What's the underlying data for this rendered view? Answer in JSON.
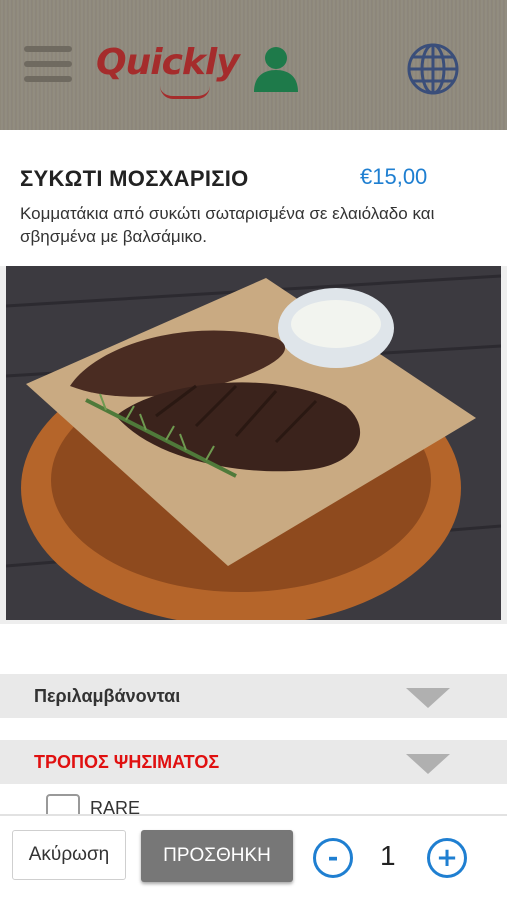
{
  "app": {
    "logo_text": "Quickly"
  },
  "product": {
    "name": "ΣΥΚΩΤΙ ΜΟΣΧΑΡΙΣΙΟ",
    "price": "€15,00",
    "description": "Κομματάκια από συκώτι σωταρισμένα σε ελαιόλαδο και σβησμένα με βαλσάμικο."
  },
  "sections": [
    {
      "label": "Περιλαμβάνονται",
      "color": "#333333",
      "expanded": false
    },
    {
      "label": "ΤΡΟΠΟΣ ΨΗΣΙΜΑΤΟΣ",
      "color": "#e01010",
      "expanded": true
    }
  ],
  "options": [
    {
      "label": "RARE",
      "checked": false
    }
  ],
  "actions": {
    "cancel_label": "Ακύρωση",
    "add_label": "ΠΡΟΣΘΗΚΗ",
    "decrement": "-",
    "increment": "+"
  },
  "quantity": "1",
  "colors": {
    "accent_blue": "#1f7fd1",
    "brand_red": "#a52c2c",
    "required_red": "#e01010"
  }
}
